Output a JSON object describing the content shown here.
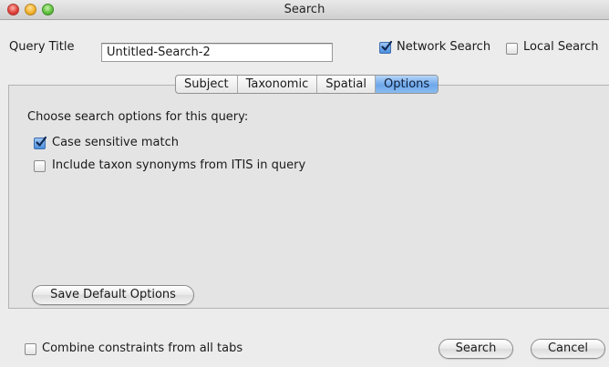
{
  "window": {
    "title": "Search"
  },
  "query": {
    "label": "Query Title",
    "value": "Untitled-Search-2"
  },
  "scope": {
    "network_search": {
      "label": "Network Search",
      "checked": true
    },
    "local_search": {
      "label": "Local Search",
      "checked": false
    }
  },
  "tabs": [
    {
      "label": "Subject",
      "active": false
    },
    {
      "label": "Taxonomic",
      "active": false
    },
    {
      "label": "Spatial",
      "active": false
    },
    {
      "label": "Options",
      "active": true
    }
  ],
  "options_panel": {
    "heading": "Choose search options for this query:",
    "case_sensitive": {
      "label": "Case sensitive match",
      "checked": true
    },
    "include_synonyms": {
      "label": "Include taxon synonyms from ITIS in query",
      "checked": false
    },
    "save_defaults_label": "Save Default Options"
  },
  "footer": {
    "combine": {
      "label": "Combine constraints from all tabs",
      "checked": false
    },
    "search_label": "Search",
    "cancel_label": "Cancel"
  },
  "colors": {
    "accent": "#4a8fde",
    "window_bg": "#ececec"
  }
}
